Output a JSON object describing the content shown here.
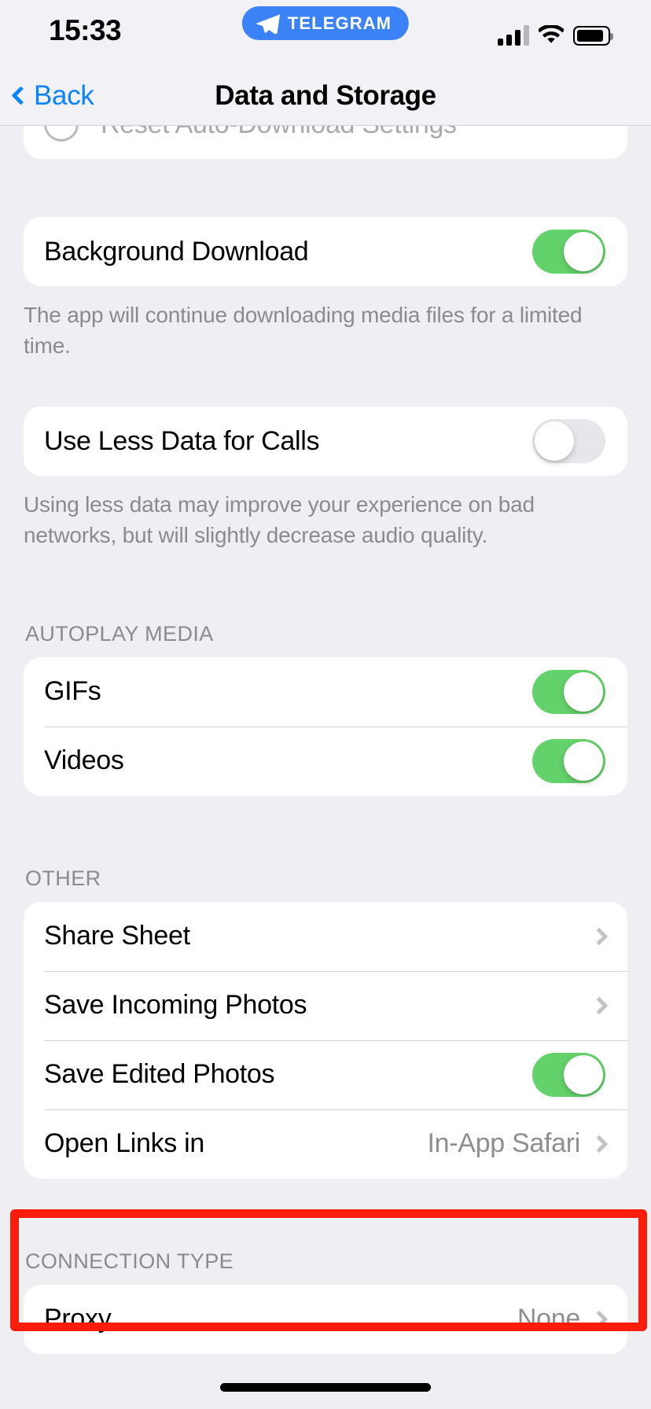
{
  "status_bar": {
    "time": "15:33",
    "app_pill_label": "TELEGRAM",
    "app_pill_icon": "telegram-plane-icon",
    "cellular_icon": "cellular-signal-icon",
    "cellular_bars_filled": 3,
    "cellular_bars_total": 4,
    "wifi_icon": "wifi-icon",
    "battery_icon": "battery-icon",
    "battery_level_percent": 82
  },
  "nav_bar": {
    "back_label": "Back",
    "back_icon": "chevron-left-icon",
    "title": "Data and Storage"
  },
  "colors": {
    "accent_blue": "#0a84ff",
    "toggle_on_green": "#64d26a",
    "toggle_off_gray": "#e6e6eb",
    "page_background": "#eeeef3",
    "card_background": "#ffffff",
    "secondary_text": "#8e8e93",
    "annotation_red": "#fc1c0a"
  },
  "sections": {
    "clipped_top": {
      "rows": [
        {
          "label": "Reset Auto-Download Settings",
          "type": "action",
          "icon": "radio-circle-icon",
          "dimmed": true
        }
      ]
    },
    "background_download": {
      "rows": [
        {
          "label": "Background Download",
          "type": "toggle",
          "value": "on"
        }
      ],
      "footer": "The app will continue downloading media files for a limited time."
    },
    "calls": {
      "rows": [
        {
          "label": "Use Less Data for Calls",
          "type": "toggle",
          "value": "off"
        }
      ],
      "footer": "Using less data may improve your experience on bad networks, but will slightly decrease audio quality."
    },
    "autoplay_media": {
      "header": "AUTOPLAY MEDIA",
      "rows": [
        {
          "label": "GIFs",
          "type": "toggle",
          "value": "on"
        },
        {
          "label": "Videos",
          "type": "toggle",
          "value": "on"
        }
      ]
    },
    "other": {
      "header": "OTHER",
      "rows": [
        {
          "label": "Share Sheet",
          "type": "disclosure",
          "value": ""
        },
        {
          "label": "Save Incoming Photos",
          "type": "disclosure",
          "value": ""
        },
        {
          "label": "Save Edited Photos",
          "type": "toggle",
          "value": "on"
        },
        {
          "label": "Open Links in",
          "type": "disclosure",
          "value": "In-App Safari"
        }
      ]
    },
    "connection_type": {
      "header": "CONNECTION TYPE",
      "rows": [
        {
          "label": "Proxy",
          "type": "disclosure",
          "value": "None",
          "highlighted": true
        }
      ]
    }
  }
}
